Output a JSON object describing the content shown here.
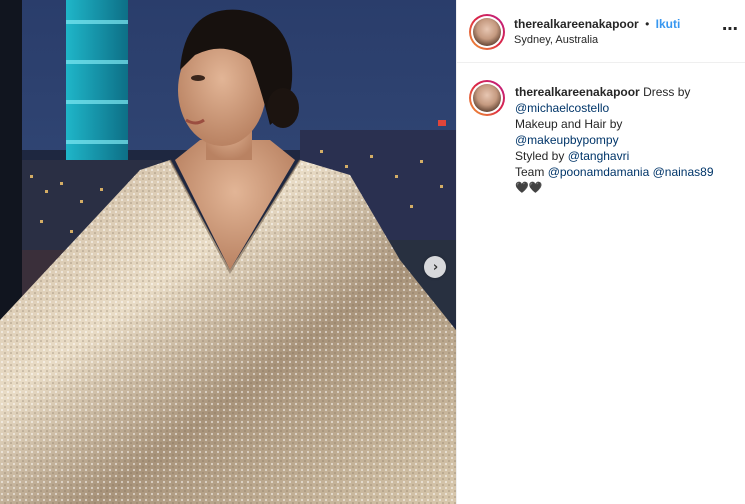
{
  "post": {
    "username": "therealkareenakapoor",
    "follow_label": "Ikuti",
    "separator": "•",
    "location": "Sydney, Australia",
    "more_icon": "⋯"
  },
  "caption": {
    "author": "therealkareenakapoor",
    "line1_text": "Dress by",
    "line2_mention": "@michaelcostello",
    "line3_text": "Makeup and Hair by",
    "line4_mention": "@makeupbypompy",
    "line5_text": "Styled by",
    "line5_mention": "@tanghavri",
    "line6_text": "Team",
    "line6_mention1": "@poonamdamania",
    "line6_mention2": "@nainas89",
    "hearts": "🖤🖤"
  },
  "carousel": {
    "next_icon": "›"
  },
  "colors": {
    "follow_blue": "#3897f0",
    "mention_navy": "#003569",
    "divider": "#efefef"
  }
}
